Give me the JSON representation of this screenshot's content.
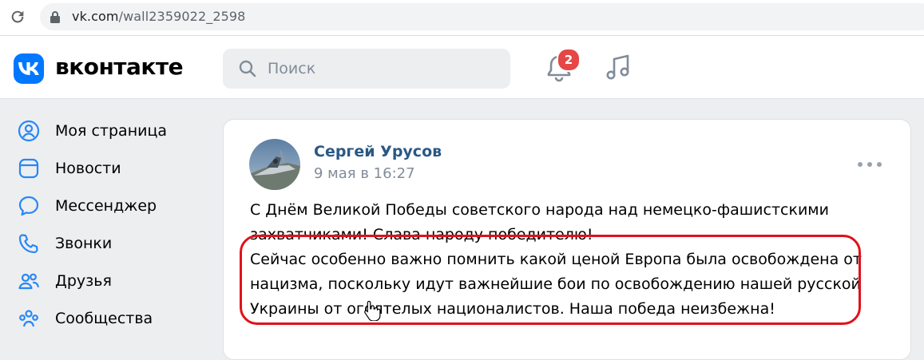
{
  "browser": {
    "url_host": "vk.com",
    "url_path": "/wall2359022_2598"
  },
  "header": {
    "brand": "вконтакте",
    "search_placeholder": "Поиск",
    "notifications_count": "2"
  },
  "sidebar": {
    "items": [
      {
        "label": "Моя страница",
        "icon": "user-circle-icon"
      },
      {
        "label": "Новости",
        "icon": "news-icon"
      },
      {
        "label": "Мессенджер",
        "icon": "message-icon"
      },
      {
        "label": "Звонки",
        "icon": "phone-icon"
      },
      {
        "label": "Друзья",
        "icon": "friends-icon"
      },
      {
        "label": "Сообщества",
        "icon": "communities-icon"
      }
    ]
  },
  "post": {
    "author": "Сергей Урусов",
    "date": "9 мая в 16:27",
    "lines": [
      "С Днём Великой Победы советского народа над немецко-фашистскими",
      "захватчиками! Слава народу победителю!",
      "Сейчас особенно важно помнить какой ценой Европа была освобождена от",
      "нацизма, поскольку идут важнейшие бои по освобождению нашей русской",
      "Украины от оголтелых националистов. Наша победа неизбежна!"
    ]
  },
  "colors": {
    "vk_blue": "#0077ff",
    "link_blue": "#2a5885",
    "badge_red": "#e64646",
    "highlight_red": "#e0121a"
  }
}
